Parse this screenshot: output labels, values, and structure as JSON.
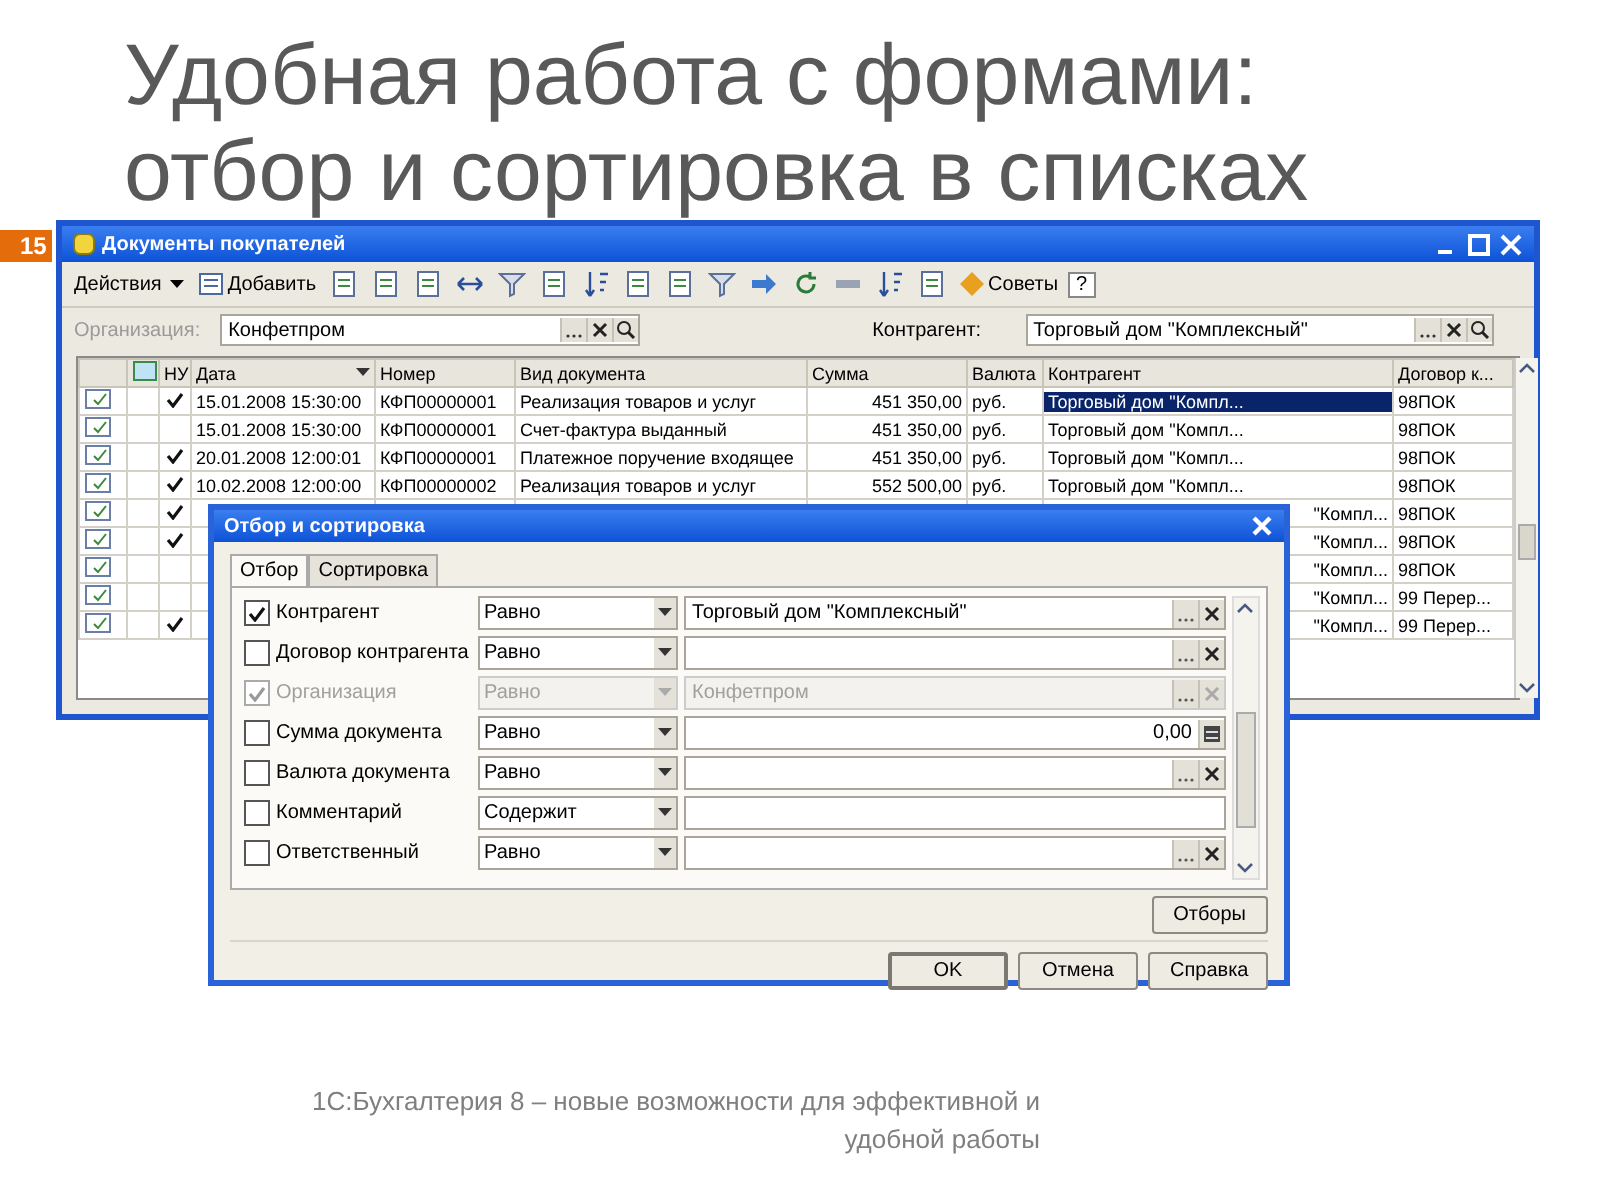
{
  "slide": {
    "title_lines": [
      "Удобная работа с формами:",
      "отбор и сортировка в списках"
    ],
    "number": "15",
    "footer_lines": [
      "1С:Бухгалтерия 8 – новые возможности для эффективной и",
      "удобной работы"
    ]
  },
  "window": {
    "title": "Документы покупателей",
    "toolbar": {
      "actions": "Действия",
      "add": "Добавить",
      "tips": "Советы",
      "help": "?"
    },
    "filters": [
      {
        "label": "Организация:",
        "value": "Конфетпром",
        "disabled": true
      },
      {
        "label": "Контрагент:",
        "value": "Торговый дом \"Комплексный\"",
        "disabled": false
      }
    ],
    "table": {
      "columns": [
        "НУ",
        "Дата",
        "Номер",
        "Вид документа",
        "Сумма",
        "Валюта",
        "Контрагент",
        "Договор к..."
      ],
      "rows": [
        {
          "nu": true,
          "date": "15.01.2008 15:30:00",
          "number": "КФП00000001",
          "doc_type": "Реализация товаров и услуг",
          "sum": "451 350,00",
          "currency": "руб.",
          "contractor": "Торговый дом \"Компл...",
          "contract": "98ПОК",
          "selected": true,
          "covered": false
        },
        {
          "nu": false,
          "date": "15.01.2008 15:30:00",
          "number": "КФП00000001",
          "doc_type": "Счет-фактура выданный",
          "sum": "451 350,00",
          "currency": "руб.",
          "contractor": "Торговый дом \"Компл...",
          "contract": "98ПОК",
          "selected": false,
          "covered": false
        },
        {
          "nu": true,
          "date": "20.01.2008 12:00:01",
          "number": "КФП00000001",
          "doc_type": "Платежное поручение входящее",
          "sum": "451 350,00",
          "currency": "руб.",
          "contractor": "Торговый дом \"Компл...",
          "contract": "98ПОК",
          "selected": false,
          "covered": false
        },
        {
          "nu": true,
          "date": "10.02.2008 12:00:00",
          "number": "КФП00000002",
          "doc_type": "Реализация товаров и услуг",
          "sum": "552 500,00",
          "currency": "руб.",
          "contractor": "Торговый дом \"Компл...",
          "contract": "98ПОК",
          "selected": false,
          "covered": false
        },
        {
          "nu": true,
          "contractor": "\"Компл...",
          "contract": "98ПОК",
          "selected": false,
          "covered": true
        },
        {
          "nu": true,
          "contractor": "\"Компл...",
          "contract": "98ПОК",
          "selected": false,
          "covered": true
        },
        {
          "nu": false,
          "contractor": "\"Компл...",
          "contract": "98ПОК",
          "selected": false,
          "covered": true
        },
        {
          "nu": false,
          "contractor": "\"Компл...",
          "contract": "99 Перер...",
          "selected": false,
          "covered": true
        },
        {
          "nu": true,
          "contractor": "\"Компл...",
          "contract": "99 Перер...",
          "selected": false,
          "covered": true
        }
      ]
    }
  },
  "dialog": {
    "title": "Отбор и сортировка",
    "tabs": [
      {
        "label": "Отбор",
        "selected": true
      },
      {
        "label": "Сортировка",
        "selected": false
      }
    ],
    "conditions": [
      {
        "checked": true,
        "disabled": false,
        "label": "Контрагент",
        "comparison": "Равно",
        "value": "Торговый дом \"Комплексный\"",
        "kind": "select"
      },
      {
        "checked": false,
        "disabled": false,
        "label": "Договор контрагента",
        "comparison": "Равно",
        "kind": "select"
      },
      {
        "checked": true,
        "disabled": true,
        "label": "Организация",
        "comparison": "Равно",
        "value": "Конфетпром",
        "kind": "select"
      },
      {
        "checked": false,
        "disabled": false,
        "label": "Сумма документа",
        "comparison": "Равно",
        "value": "0,00",
        "kind": "number"
      },
      {
        "checked": false,
        "disabled": false,
        "label": "Валюта документа",
        "comparison": "Равно",
        "kind": "select"
      },
      {
        "checked": false,
        "disabled": false,
        "label": "Комментарий",
        "comparison": "Содержит",
        "kind": "text"
      },
      {
        "checked": false,
        "disabled": false,
        "label": "Ответственный",
        "comparison": "Равно",
        "kind": "select"
      }
    ],
    "filters_button": "Отборы",
    "buttons": [
      "OK",
      "Отмена",
      "Справка"
    ]
  }
}
